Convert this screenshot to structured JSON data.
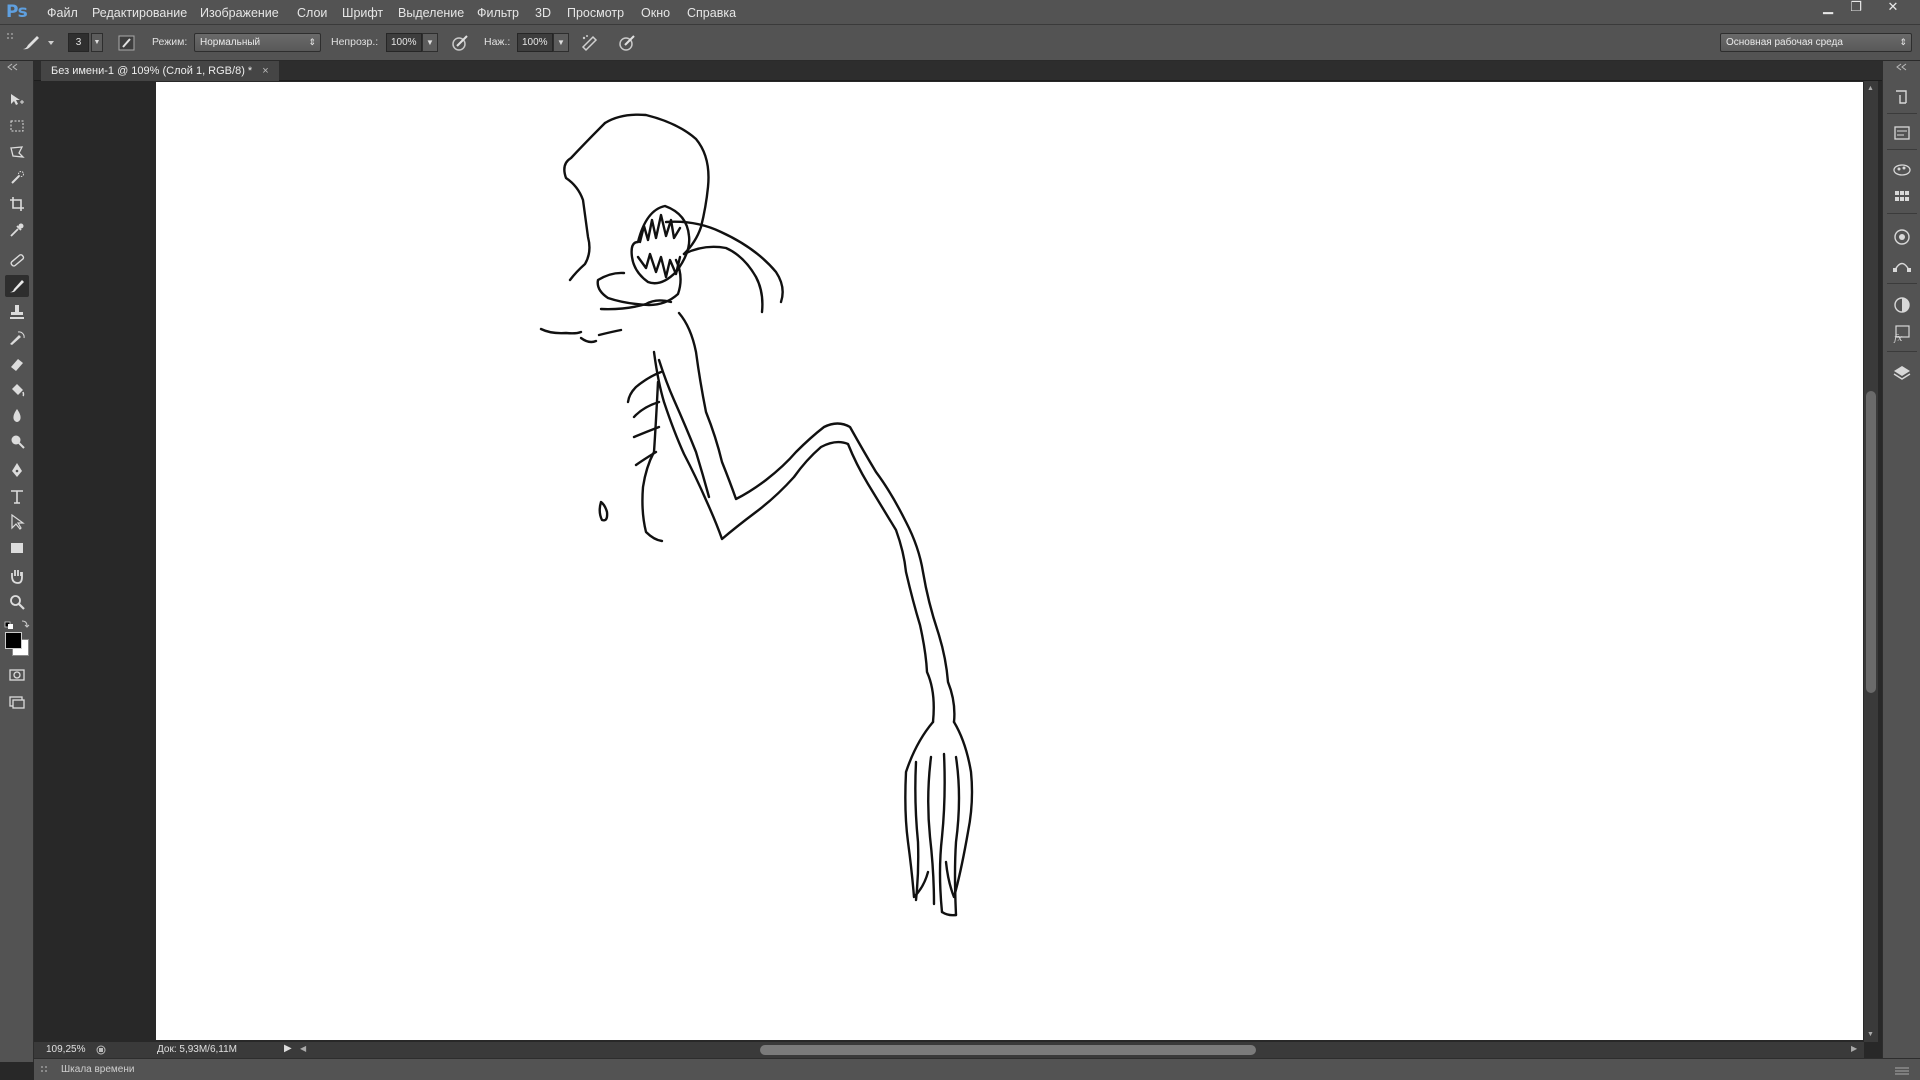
{
  "app": {
    "logo": "Ps"
  },
  "menu": [
    "Файл",
    "Редактирование",
    "Изображение",
    "Слои",
    "Шрифт",
    "Выделение",
    "Фильтр",
    "3D",
    "Просмотр",
    "Окно",
    "Справка"
  ],
  "window_controls": {
    "minimize": "▁",
    "restore": "❐",
    "close": "✕"
  },
  "options": {
    "brush_size": "3",
    "mode_label": "Режим:",
    "mode_value": "Нормальный",
    "opacity_label": "Непрозр.:",
    "opacity_value": "100%",
    "pressure_label": "Наж.:",
    "pressure_value": "100%",
    "workspace_value": "Основная рабочая среда"
  },
  "document": {
    "tab_title": "Без имени-1 @ 109% (Слой 1, RGB/8) *",
    "tab_close": "×"
  },
  "status": {
    "zoom": "109,25%",
    "doc_size": "Док: 5,93M/6,11M"
  },
  "timeline": {
    "label": "Шкала времени"
  },
  "tools": [
    "move-icon",
    "marquee-icon",
    "lasso-icon",
    "quick-select-icon",
    "crop-icon",
    "eyedropper-icon",
    "healing-icon",
    "brush-icon",
    "stamp-icon",
    "history-brush-icon",
    "eraser-icon",
    "paint-bucket-icon",
    "blur-icon",
    "dodge-icon",
    "pen-icon",
    "type-icon",
    "path-select-icon",
    "rectangle-icon",
    "hand-icon",
    "zoom-icon"
  ],
  "colors": {
    "foreground": "#000000",
    "background": "#ffffff",
    "ui": "#535353",
    "canvas": "#ffffff"
  }
}
